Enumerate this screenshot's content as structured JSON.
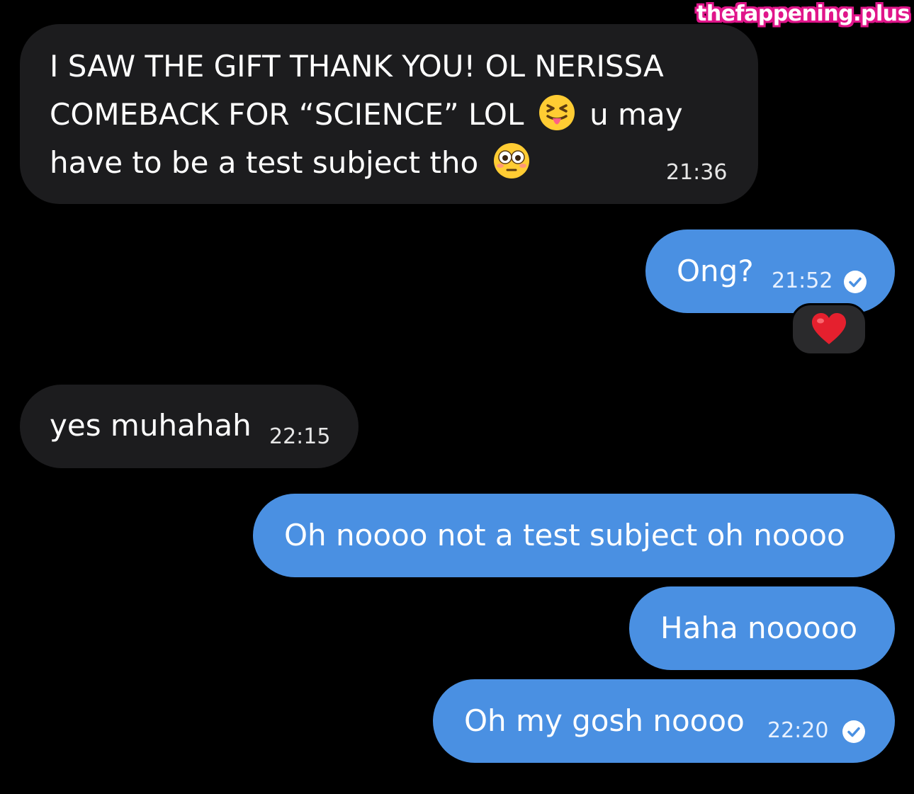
{
  "watermark": "thefappening.plus",
  "colors": {
    "background": "#000000",
    "incoming_bubble": "#1c1c1e",
    "outgoing_bubble": "#4a90e2",
    "watermark_outline": "#e0158a"
  },
  "messages": [
    {
      "direction": "incoming",
      "lines": [
        "I SAW THE GIFT THANK YOU! OL NERISSA",
        "COMEBACK FOR “SCIENCE” LOL",
        "u may",
        "have to be a test subject tho"
      ],
      "emojis": [
        "squinting-face-with-tongue-emoji",
        "flushed-face-emoji"
      ],
      "time": "21:36"
    },
    {
      "direction": "outgoing",
      "text": "Ong?",
      "time": "21:52",
      "read": true,
      "reaction": "red-heart-emoji"
    },
    {
      "direction": "incoming",
      "text": "yes muhahah",
      "time": "22:15"
    },
    {
      "direction": "outgoing",
      "text": "Oh noooo not a test subject oh noooo"
    },
    {
      "direction": "outgoing",
      "text": "Haha nooooo"
    },
    {
      "direction": "outgoing",
      "text": "Oh my gosh noooo",
      "time": "22:20",
      "read": true
    }
  ]
}
